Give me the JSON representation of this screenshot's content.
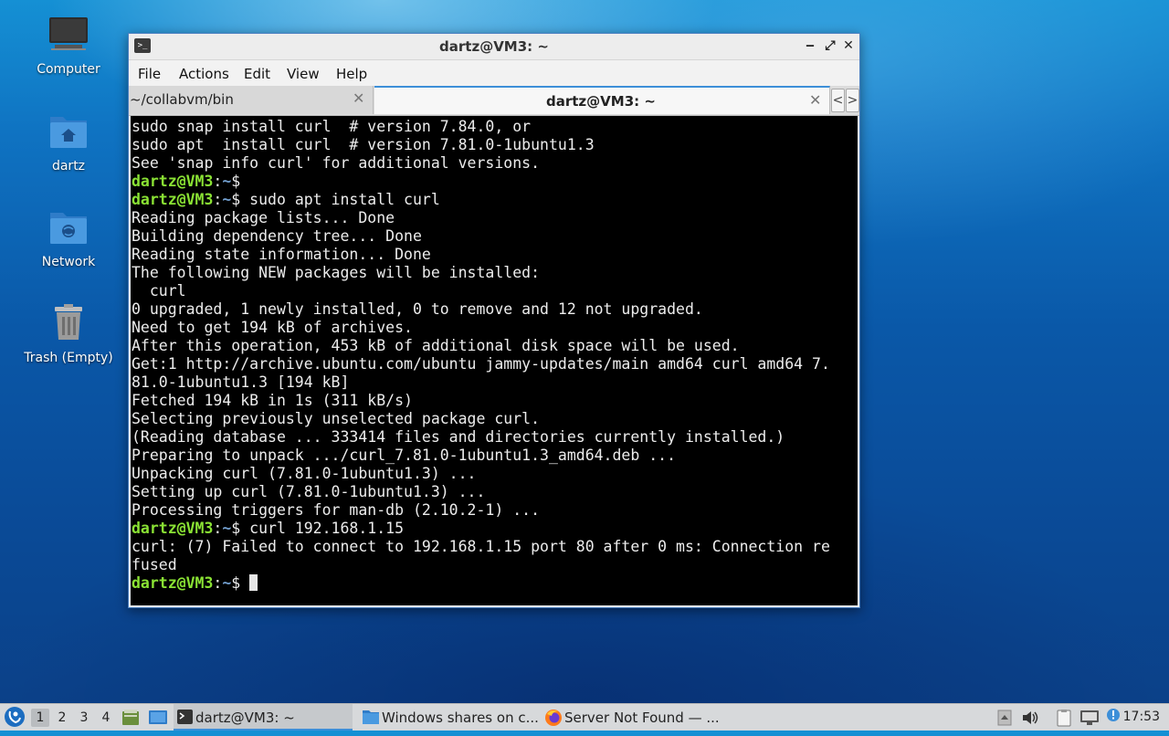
{
  "desktop": {
    "icons": [
      {
        "label": "Computer"
      },
      {
        "label": "dartz"
      },
      {
        "label": "Network"
      },
      {
        "label": "Trash (Empty)"
      }
    ]
  },
  "window": {
    "title": "dartz@VM3: ~",
    "title_icon": ">_",
    "controls": {
      "minimize": "‒",
      "maximize": "⤢",
      "close": "✕"
    },
    "menu": [
      "File",
      "Actions",
      "Edit",
      "View",
      "Help"
    ],
    "tabs": [
      {
        "label": "~/collabvm/bin",
        "close": "✕",
        "active": false
      },
      {
        "label": "dartz@VM3: ~",
        "close": "✕",
        "active": true
      }
    ],
    "tab_nav": {
      "prev": "<",
      "next": ">"
    }
  },
  "terminal": {
    "prompt_user": "dartz@VM3",
    "prompt_sep": ":",
    "prompt_path": "~",
    "prompt_sign": "$",
    "lines": [
      {
        "text": "sudo snap install curl  # version 7.84.0, or"
      },
      {
        "text": "sudo apt  install curl  # version 7.81.0-1ubuntu1.3"
      },
      {
        "text": "See 'snap info curl' for additional versions."
      },
      {
        "prompt": true,
        "cmd": ""
      },
      {
        "prompt": true,
        "cmd": " sudo apt install curl"
      },
      {
        "text": "Reading package lists... Done"
      },
      {
        "text": "Building dependency tree... Done"
      },
      {
        "text": "Reading state information... Done"
      },
      {
        "text": "The following NEW packages will be installed:"
      },
      {
        "text": "  curl"
      },
      {
        "text": "0 upgraded, 1 newly installed, 0 to remove and 12 not upgraded."
      },
      {
        "text": "Need to get 194 kB of archives."
      },
      {
        "text": "After this operation, 453 kB of additional disk space will be used."
      },
      {
        "text": "Get:1 http://archive.ubuntu.com/ubuntu jammy-updates/main amd64 curl amd64 7."
      },
      {
        "text": "81.0-1ubuntu1.3 [194 kB]"
      },
      {
        "text": "Fetched 194 kB in 1s (311 kB/s)"
      },
      {
        "text": "Selecting previously unselected package curl."
      },
      {
        "text": "(Reading database ... 333414 files and directories currently installed.)"
      },
      {
        "text": "Preparing to unpack .../curl_7.81.0-1ubuntu1.3_amd64.deb ..."
      },
      {
        "text": "Unpacking curl (7.81.0-1ubuntu1.3) ..."
      },
      {
        "text": "Setting up curl (7.81.0-1ubuntu1.3) ..."
      },
      {
        "text": "Processing triggers for man-db (2.10.2-1) ..."
      },
      {
        "prompt": true,
        "cmd": " curl 192.168.1.15"
      },
      {
        "text": "curl: (7) Failed to connect to 192.168.1.15 port 80 after 0 ms: Connection re"
      },
      {
        "text": "fused"
      },
      {
        "prompt": true,
        "cmd": " ",
        "cursor": true
      }
    ]
  },
  "taskbar": {
    "workspaces": [
      "1",
      "2",
      "3",
      "4"
    ],
    "active_workspace": "1",
    "tasks": [
      {
        "label": "dartz@VM3: ~",
        "icon": "terminal-icon",
        "active": true
      },
      {
        "label": "Windows shares on c...",
        "icon": "folder-icon",
        "active": false
      },
      {
        "label": "Server Not Found — ...",
        "icon": "firefox-icon",
        "active": false
      }
    ],
    "clock": "17:53"
  },
  "colors": {
    "prompt_user": "#8ae234",
    "prompt_path": "#729fcf",
    "accent": "#3d8fd8"
  }
}
